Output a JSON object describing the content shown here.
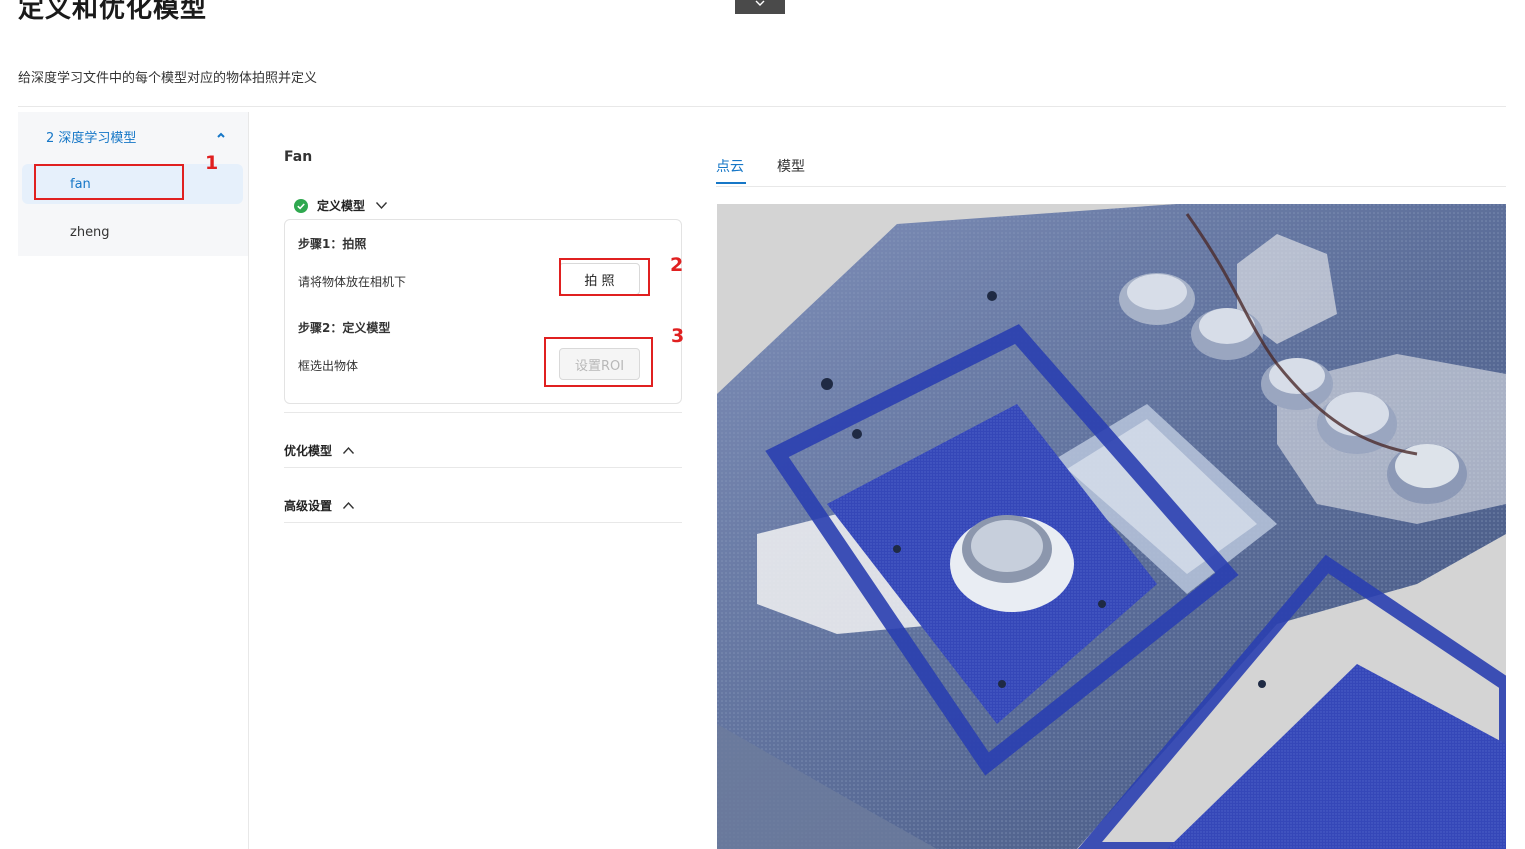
{
  "page": {
    "title": "定义和优化模型",
    "description": "给深度学习文件中的每个模型对应的物体拍照并定义"
  },
  "sidebar": {
    "group_label": "2 深度学习模型",
    "items": [
      {
        "label": "fan",
        "active": true
      },
      {
        "label": "zheng",
        "active": false
      }
    ]
  },
  "model_panel": {
    "title": "Fan",
    "define_section": {
      "label": "定义模型",
      "status": "completed",
      "step1": {
        "title": "步骤1：拍照",
        "instruction": "请将物体放在相机下",
        "button_label": "拍 照"
      },
      "step2": {
        "title": "步骤2：定义模型",
        "instruction": "框选出物体",
        "button_label": "设置ROI"
      }
    },
    "optimize_section": {
      "label": "优化模型"
    },
    "advanced_section": {
      "label": "高级设置"
    }
  },
  "view_tabs": {
    "tabs": [
      {
        "label": "点云",
        "active": true
      },
      {
        "label": "模型",
        "active": false
      }
    ]
  },
  "annotations": [
    "1",
    "2",
    "3"
  ],
  "colors": {
    "accent": "#1677c7",
    "annotation": "#e02020",
    "success": "#2fa84f"
  }
}
